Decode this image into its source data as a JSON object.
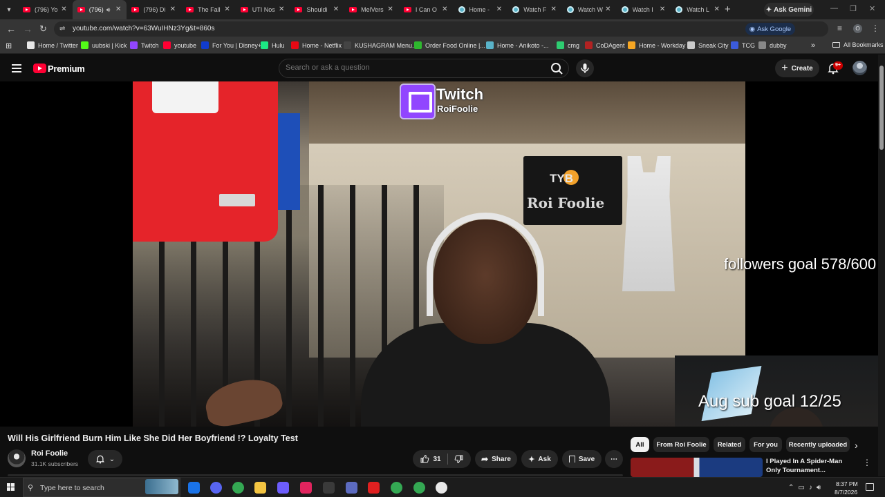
{
  "browser": {
    "tabs": [
      {
        "label": "(796) Yo",
        "favicon": "youtube-icon",
        "active": false
      },
      {
        "label": "(796)",
        "favicon": "youtube-icon",
        "active": true,
        "audio": true
      },
      {
        "label": "(796) Di",
        "favicon": "youtube-icon",
        "active": false
      },
      {
        "label": "The Fall",
        "favicon": "youtube-icon",
        "active": false
      },
      {
        "label": "UTI Nos",
        "favicon": "youtube-icon",
        "active": false
      },
      {
        "label": "Shouldi",
        "favicon": "youtube-icon",
        "active": false
      },
      {
        "label": "MelVers",
        "favicon": "youtube-icon",
        "active": false
      },
      {
        "label": "I Can O",
        "favicon": "youtube-icon",
        "active": false
      },
      {
        "label": "Home -",
        "favicon": "globe-icon",
        "active": false
      },
      {
        "label": "Watch F",
        "favicon": "globe-icon",
        "active": false
      },
      {
        "label": "Watch W",
        "favicon": "globe-icon",
        "active": false
      },
      {
        "label": "Watch I",
        "favicon": "globe-icon",
        "active": false
      },
      {
        "label": "Watch L",
        "favicon": "globe-icon",
        "active": false
      }
    ],
    "gemini_label": "Ask Gemini",
    "url": "youtube.com/watch?v=63WuIHNz3Yg&t=860s",
    "ask_google_label": "Ask Google",
    "profile_initial": "O",
    "bookmarks": [
      {
        "label": "Home / Twitter",
        "color": "#e7e7e7"
      },
      {
        "label": "uubski | Kick",
        "color": "#53fc18"
      },
      {
        "label": "Twitch",
        "color": "#9146ff"
      },
      {
        "label": "youtube",
        "color": "#ff0033"
      },
      {
        "label": "For You | Disney+",
        "color": "#113ccf"
      },
      {
        "label": "Hulu",
        "color": "#1ce783"
      },
      {
        "label": "Home - Netflix",
        "color": "#e50914"
      },
      {
        "label": "KUSHAGRAM Menu...",
        "color": "#444444"
      },
      {
        "label": "Order Food Online |...",
        "color": "#2eb82e"
      },
      {
        "label": "Home - Anikoto -...",
        "color": "#59b3c9"
      },
      {
        "label": "cmg",
        "color": "#2ecc71"
      },
      {
        "label": "CoDAgent",
        "color": "#b22222"
      },
      {
        "label": "Home - Workday",
        "color": "#f5a623"
      },
      {
        "label": "Sneak City",
        "color": "#cccccc"
      },
      {
        "label": "TCG",
        "color": "#3b5bdb"
      },
      {
        "label": "dubby",
        "color": "#888888"
      }
    ],
    "all_bookmarks_label": "All Bookmarks"
  },
  "youtube": {
    "brand": "Premium",
    "search_placeholder": "Search or ask a question",
    "create_label": "Create",
    "notification_count": "9+"
  },
  "video": {
    "overlay_twitch": "Twitch",
    "overlay_user": "RoiFoolie",
    "banner_brand": "TYB",
    "banner_name": "Roi Foolie",
    "followers_goal": "followers goal 578/600",
    "sub_goal": "Aug sub goal 12/25",
    "title": "Will His Girlfriend Burn Him Like She Did Her Boyfriend !? Loyalty Test",
    "channel_name": "Roi Foolie",
    "subscribers": "31.1K subscribers",
    "like_count": "31",
    "share_label": "Share",
    "ask_label": "Ask",
    "save_label": "Save"
  },
  "sidebar": {
    "chips": [
      "All",
      "From Roi Foolie",
      "Related",
      "For you",
      "Recently uploaded"
    ],
    "recommended_title": "I Played In A Spider-Man Only Tournament..."
  },
  "taskbar": {
    "search_text": "Type here to search",
    "time": "8:37 PM",
    "date": "8/7/2026",
    "apps": [
      {
        "name": "edge-icon",
        "color": "#1a73e8"
      },
      {
        "name": "discord-icon",
        "color": "#5865f2"
      },
      {
        "name": "chrome-icon",
        "color": "#34a853"
      },
      {
        "name": "file-explorer-icon",
        "color": "#f4c542"
      },
      {
        "name": "game-controller-icon",
        "color": "#6d5dfc"
      },
      {
        "name": "media-player-icon",
        "color": "#e0245e"
      },
      {
        "name": "obs-icon",
        "color": "#3a3a3a"
      },
      {
        "name": "app-icon",
        "color": "#5c6bc0"
      },
      {
        "name": "acrobat-icon",
        "color": "#e02020"
      },
      {
        "name": "chrome-profile-icon",
        "color": "#34a853"
      },
      {
        "name": "chrome-alt-icon",
        "color": "#34a853"
      },
      {
        "name": "clock-app-icon",
        "color": "#e8e8e8"
      }
    ]
  }
}
